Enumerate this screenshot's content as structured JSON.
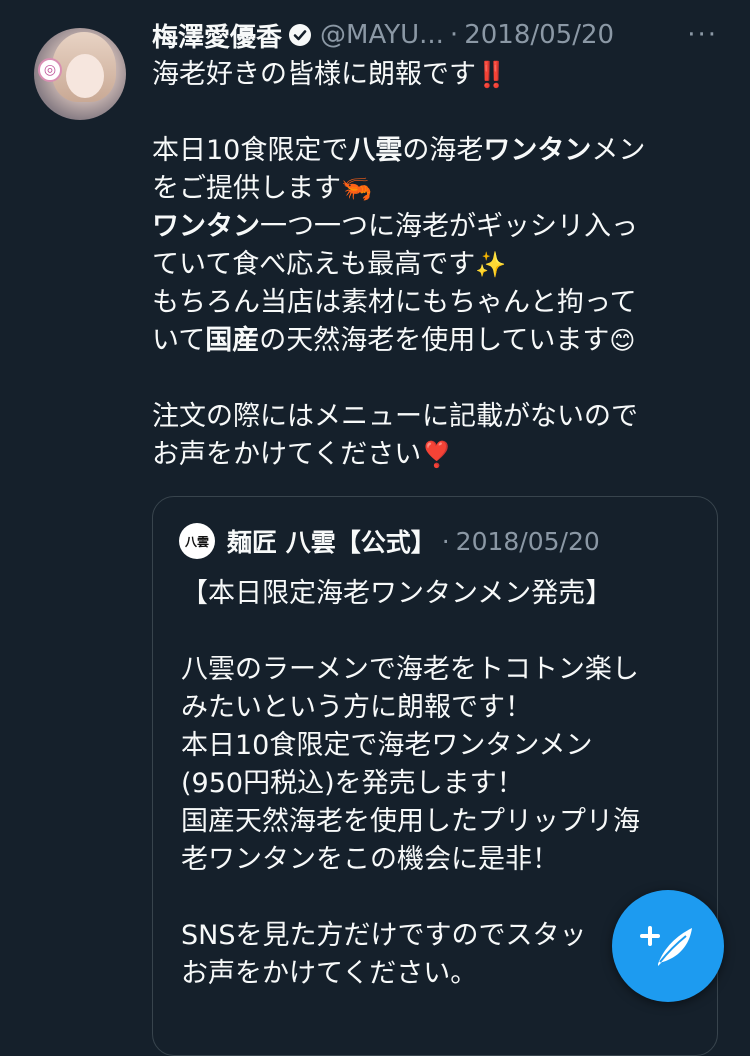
{
  "tweet": {
    "author_name": "梅澤愛優香",
    "author_handle": "@MAYU...",
    "separator": "·",
    "date": "2018/05/20",
    "more_label": "···",
    "lines": [
      [
        "海老好きの皆様に朗報です",
        "‼️"
      ],
      [
        "本日10食限定で",
        "八雲",
        "の海老",
        "ワンタン",
        "メン"
      ],
      [
        "をご提供します",
        "🦐"
      ],
      [
        "ワンタン",
        "一つ一つに海老がギッシリ入っ"
      ],
      [
        "ていて食べ応えも最高です",
        "✨"
      ],
      [
        "もちろん当店は素材にもちゃんと拘って"
      ],
      [
        "いて",
        "国産",
        "の天然海老を使用しています",
        "😊"
      ],
      [
        "注文の際にはメニューに記載がないので"
      ],
      [
        "お声をかけてください",
        "❣️"
      ]
    ]
  },
  "quoted": {
    "author_name": "麺匠 八雲【公式】",
    "avatar_text": "八雲",
    "separator": "·",
    "date": "2018/05/20",
    "lines": [
      "【本日限定海老ワンタンメン発売】",
      "八雲のラーメンで海老をトコトン楽し",
      "みたいという方に朗報です！",
      "本日10食限定で海老ワンタンメン",
      "(950円税込)を発売します！",
      "国産天然海老を使用したプリップリ海",
      "老ワンタンをこの機会に是非！",
      "SNSを見た方だけですのでスタッ",
      "お声をかけてください。"
    ]
  },
  "compose_button": {
    "icon": "compose-tweet-icon",
    "color": "#1d9bf0"
  },
  "colors": {
    "background": "#15202b",
    "text": "#f7f9f9",
    "secondary": "#8b98a5",
    "accent": "#1d9bf0",
    "border": "#38444d"
  }
}
